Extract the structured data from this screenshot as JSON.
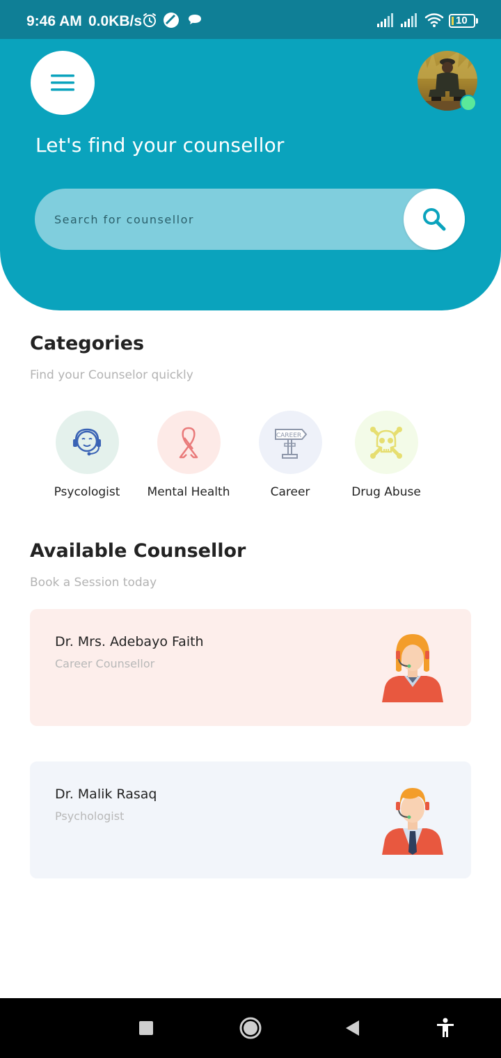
{
  "status_bar": {
    "time": "9:46 AM",
    "speed": "0.0KB/s",
    "battery": "10",
    "icons": [
      "alarm-icon",
      "edge-icon",
      "chat-icon",
      "signal-icon",
      "signal-icon",
      "wifi-icon",
      "battery-icon"
    ]
  },
  "header": {
    "greeting": "Let's find your counsellor",
    "online": true,
    "search": {
      "placeholder": "Search for counsellor",
      "value": ""
    }
  },
  "categories": {
    "title": "Categories",
    "subtitle": "Find your Counselor quickly",
    "items": [
      {
        "label": "Psycologist",
        "icon": "headset-person-icon",
        "bg": "#e4f1ec"
      },
      {
        "label": "Mental Health",
        "icon": "awareness-ribbon-icon",
        "bg": "#fdeae7"
      },
      {
        "label": "Career",
        "icon": "signpost-icon",
        "bg": "#eef1f9"
      },
      {
        "label": "Drug Abuse",
        "icon": "skull-crossbones-icon",
        "bg": "#f3fbe8"
      }
    ]
  },
  "available": {
    "title": "Available Counsellor",
    "subtitle": "Book a Session today",
    "counsellors": [
      {
        "name": "Dr. Mrs. Adebayo Faith",
        "role": "Career Counsellor",
        "bg": "#fdeeeb"
      },
      {
        "name": "Dr. Malik Rasaq",
        "role": "Psychologist",
        "bg": "#f2f5fa"
      }
    ]
  },
  "colors": {
    "primary": "#0aa3bd",
    "status_bar": "#0f7f96",
    "online": "#5be89a"
  }
}
